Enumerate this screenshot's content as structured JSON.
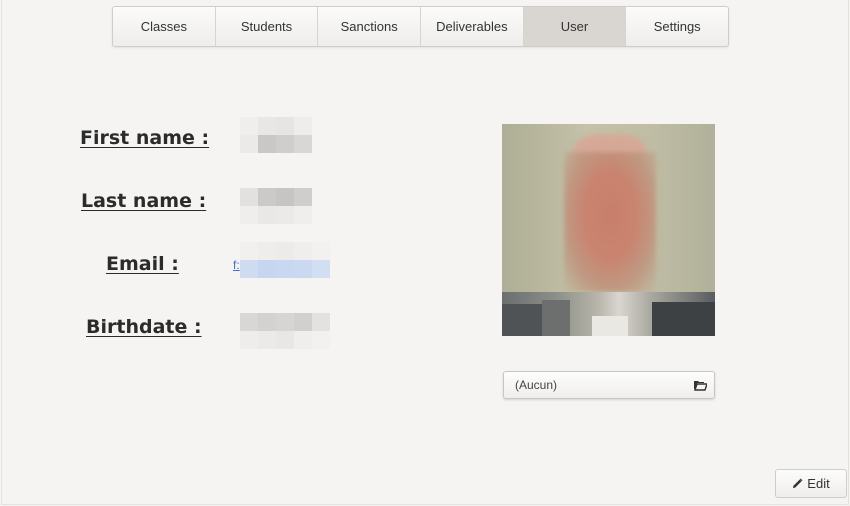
{
  "nav": {
    "tabs": [
      {
        "label": "Classes"
      },
      {
        "label": "Students"
      },
      {
        "label": "Sanctions"
      },
      {
        "label": "Deliverables"
      },
      {
        "label": "User",
        "active": true
      },
      {
        "label": "Settings"
      }
    ]
  },
  "profile": {
    "first_name_label": "First name :",
    "last_name_label": "Last name :",
    "email_label": "Email :",
    "birthdate_label": "Birthdate :",
    "email_value_visible": "f:"
  },
  "photo": {
    "file_input_value": "(Aucun)",
    "file_icon": "folder-open-icon"
  },
  "actions": {
    "edit_label": "Edit",
    "edit_icon": "pencil-icon"
  },
  "colors": {
    "background": "#f5f4f2",
    "active_tab": "#d9d6d2",
    "link": "#3b6fd1"
  }
}
